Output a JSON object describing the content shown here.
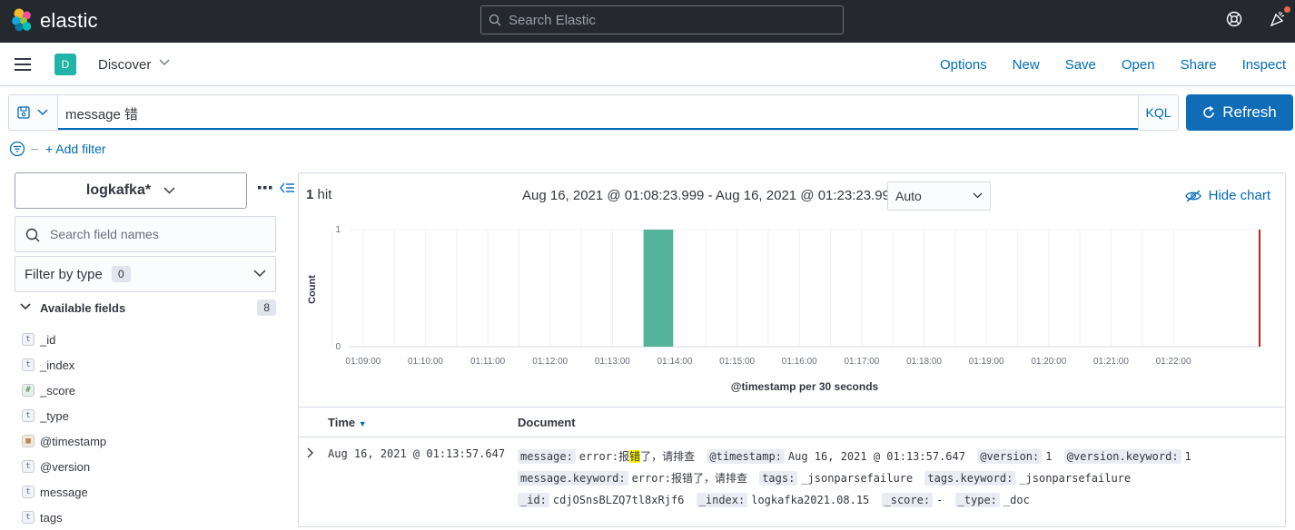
{
  "header": {
    "brand": "elastic",
    "search_placeholder": "Search Elastic"
  },
  "appbar": {
    "space_initial": "D",
    "app_title": "Discover",
    "links": [
      "Options",
      "New",
      "Save",
      "Open",
      "Share",
      "Inspect"
    ]
  },
  "query": {
    "text": "message 错",
    "language": "KQL",
    "refresh_label": "Refresh",
    "add_filter": "+ Add filter"
  },
  "sidebar": {
    "index_pattern": "logkafka*",
    "field_search_placeholder": "Search field names",
    "filter_by_type_label": "Filter by type",
    "filter_by_type_count": "0",
    "available_fields_label": "Available fields",
    "available_fields_count": "8",
    "fields": [
      {
        "type": "t",
        "name": "_id"
      },
      {
        "type": "t",
        "name": "_index"
      },
      {
        "type": "#",
        "name": "_score"
      },
      {
        "type": "t",
        "name": "_type"
      },
      {
        "type": "date",
        "name": "@timestamp"
      },
      {
        "type": "t",
        "name": "@version"
      },
      {
        "type": "t",
        "name": "message"
      },
      {
        "type": "t",
        "name": "tags"
      }
    ]
  },
  "results": {
    "hits_count": "1",
    "hits_label": "hit",
    "date_range": "Aug 16, 2021 @ 01:08:23.999 - Aug 16, 2021 @ 01:23:23.999",
    "interval": "Auto",
    "hide_chart": "Hide chart",
    "table_headers": {
      "time": "Time",
      "document": "Document"
    },
    "rows": [
      {
        "time": "Aug 16, 2021 @ 01:13:57.647",
        "fields": {
          "message_key": "message:",
          "message_prefix": "error:报",
          "message_highlight": "错",
          "message_suffix": "了，请排查",
          "timestamp_key": "@timestamp:",
          "timestamp_val": "Aug 16, 2021 @ 01:13:57.647",
          "version_key": "@version:",
          "version_val": "1",
          "version_kw_key": "@version.keyword:",
          "version_kw_val": "1",
          "message_kw_key": "message.keyword:",
          "message_kw_val": "error:报错了，请排查",
          "tags_key": "tags:",
          "tags_val": "_jsonparsefailure",
          "tags_kw_key": "tags.keyword:",
          "tags_kw_val": "_jsonparsefailure",
          "id_key": "_id:",
          "id_val": "cdjOSnsBLZQ7tl8xRjf6",
          "index_key": "_index:",
          "index_val": "logkafka2021.08.15",
          "score_key": "_score:",
          "score_val": "-",
          "type_key": "_type:",
          "type_val": "_doc"
        }
      }
    ]
  },
  "chart_data": {
    "type": "bar",
    "xlabel": "@timestamp per 30 seconds",
    "ylabel": "Count",
    "ylim": [
      0,
      1
    ],
    "y_ticks": [
      "1",
      "0"
    ],
    "x_ticks": [
      "01:09:00",
      "01:10:00",
      "01:11:00",
      "01:12:00",
      "01:13:00",
      "01:14:00",
      "01:15:00",
      "01:16:00",
      "01:17:00",
      "01:18:00",
      "01:19:00",
      "01:20:00",
      "01:21:00",
      "01:22:00"
    ],
    "categories": [
      "01:13:30"
    ],
    "values": [
      1
    ],
    "bar_color": "#54b399",
    "now_marker_color": "#bd271e"
  }
}
